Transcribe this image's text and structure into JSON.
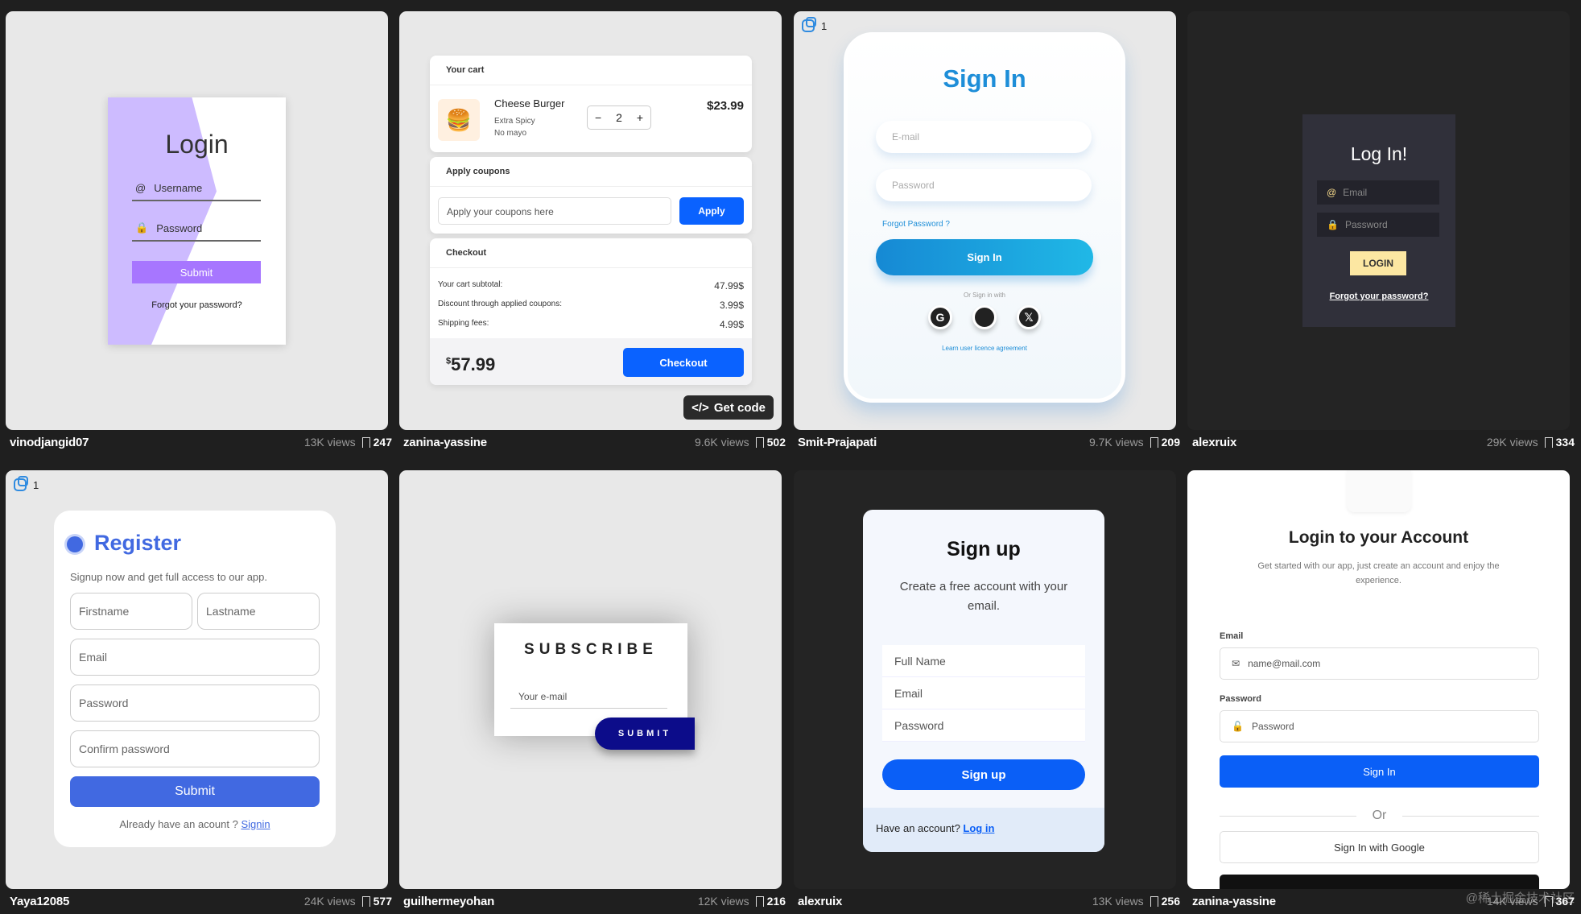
{
  "cards": [
    {
      "author": "vinodjangid07",
      "views": "13K views",
      "saves": "247"
    },
    {
      "author": "zanina-yassine",
      "views": "9.6K views",
      "saves": "502"
    },
    {
      "author": "Smit-Prajapati",
      "views": "9.7K views",
      "saves": "209"
    },
    {
      "author": "alexruix",
      "views": "29K views",
      "saves": "334"
    },
    {
      "author": "Yaya12085",
      "views": "24K views",
      "saves": "577"
    },
    {
      "author": "guilhermeyohan",
      "views": "12K views",
      "saves": "216"
    },
    {
      "author": "alexruix",
      "views": "13K views",
      "saves": "256"
    },
    {
      "author": "zanina-yassine",
      "views": "14K views",
      "saves": "367"
    }
  ],
  "badges": {
    "t3": "1",
    "t5": "1"
  },
  "t1": {
    "title": "Login",
    "username": "Username",
    "password": "Password",
    "submit": "Submit",
    "forgot": "Forgot your password?"
  },
  "t2": {
    "cart_header": "Your cart",
    "product": "Cheese Burger",
    "opt1": "Extra Spicy",
    "opt2": "No mayo",
    "qty": "2",
    "price": "$23.99",
    "coupons_header": "Apply coupons",
    "coupon_placeholder": "Apply your coupons here",
    "apply": "Apply",
    "checkout_header": "Checkout",
    "rows": [
      {
        "label": "Your cart subtotal:",
        "value": "47.99$"
      },
      {
        "label": "Discount through applied coupons:",
        "value": "3.99$"
      },
      {
        "label": "Shipping fees:",
        "value": "4.99$"
      }
    ],
    "total_symbol": "$",
    "total": "57.99",
    "checkout": "Checkout",
    "get_code": "Get code"
  },
  "t3": {
    "title": "Sign In",
    "email": "E-mail",
    "password": "Password",
    "forgot": "Forgot Password ?",
    "button": "Sign In",
    "or": "Or Sign in with",
    "license": "Learn user licence agreement"
  },
  "t4": {
    "title": "Log In!",
    "email": "Email",
    "password": "Password",
    "button": "LOGIN",
    "forgot": "Forgot your password?"
  },
  "t5": {
    "title": "Register",
    "sub": "Signup now and get full access to our app.",
    "firstname": "Firstname",
    "lastname": "Lastname",
    "email": "Email",
    "password": "Password",
    "confirm": "Confirm password",
    "submit": "Submit",
    "have": "Already have an acount ?",
    "signin": "Signin"
  },
  "t6": {
    "title": "SUBSCRIBE",
    "email": "Your e-mail",
    "submit": "SUBMIT"
  },
  "t7": {
    "title": "Sign up",
    "sub": "Create a free account with your email.",
    "fullname": "Full Name",
    "email": "Email",
    "password": "Password",
    "button": "Sign up",
    "have": "Have an account?",
    "login": "Log in"
  },
  "t8": {
    "title": "Login to your Account",
    "sub": "Get started with our app, just create an account and enjoy the experience.",
    "email_label": "Email",
    "email_placeholder": "name@mail.com",
    "password_label": "Password",
    "password_placeholder": "Password",
    "signin": "Sign In",
    "or": "Or",
    "google": "Sign In with Google"
  },
  "watermark": "@稀土掘金技术社区"
}
